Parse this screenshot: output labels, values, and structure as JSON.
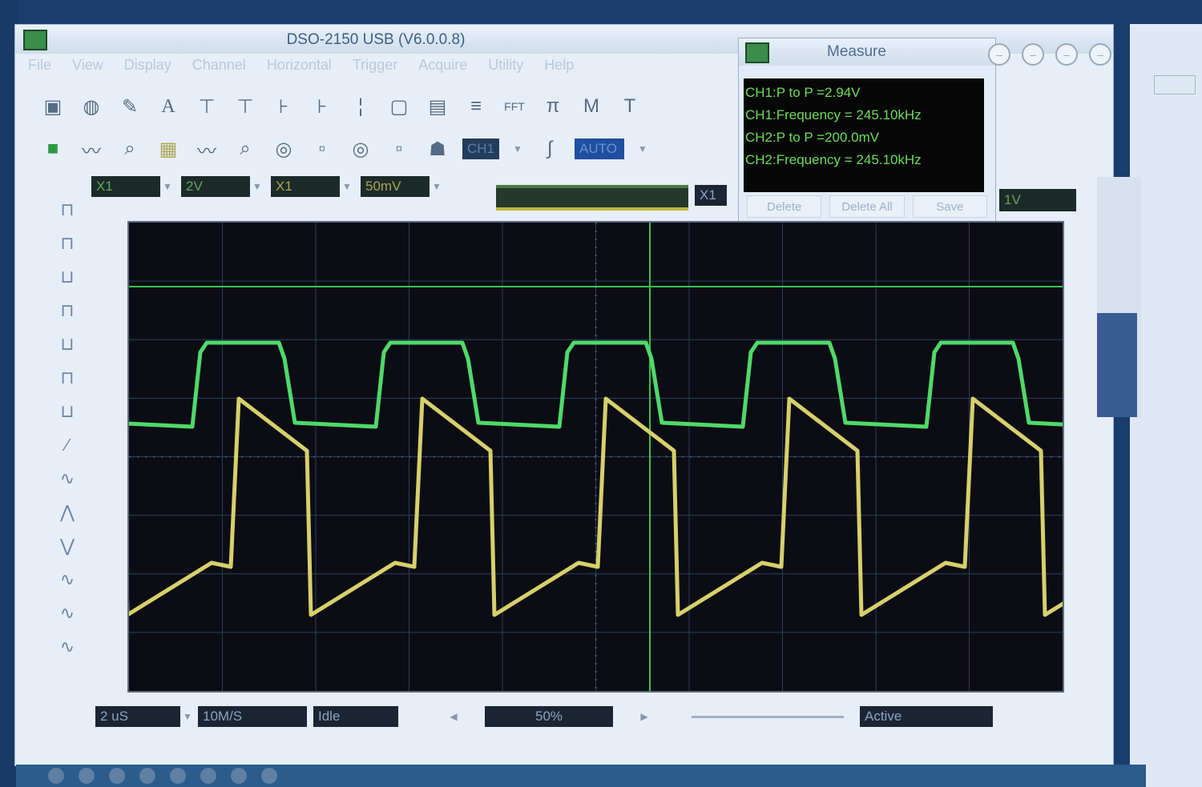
{
  "window": {
    "title": "DSO-2150 USB (V6.0.0.8)"
  },
  "menu": [
    "File",
    "View",
    "Display",
    "Channel",
    "Horizontal",
    "Trigger",
    "Acquire",
    "Utility",
    "Help"
  ],
  "toolbar": {
    "text_tool": "A",
    "m_button": "M",
    "t_button": "T",
    "fft_button": "FFT",
    "trigger_source": "CH1",
    "trigger_mode": "AUTO"
  },
  "channels": {
    "ch1_probe": "X1",
    "ch1_volts_div": "2V",
    "ch2_probe": "X1",
    "ch2_volts_div": "50mV",
    "math_probe": "X1",
    "ref_volts": "1V"
  },
  "measure": {
    "title": "Measure",
    "lines": [
      "CH1:P to P =2.94V",
      "CH1:Frequency = 245.10kHz",
      "CH2:P to P =200.0mV",
      "CH2:Frequency = 245.10kHz"
    ],
    "delete_label": "Delete",
    "delete_all_label": "Delete All",
    "save_label": "Save"
  },
  "bottom": {
    "time_div": "2 uS",
    "samples": "10M/S",
    "acquire": "Idle",
    "position": "50%",
    "status": "Active"
  },
  "colors": {
    "ch1": "#4fd96a",
    "ch2": "#d7d06a",
    "grid": "#28405a",
    "cursor": "#3ac24b"
  }
}
